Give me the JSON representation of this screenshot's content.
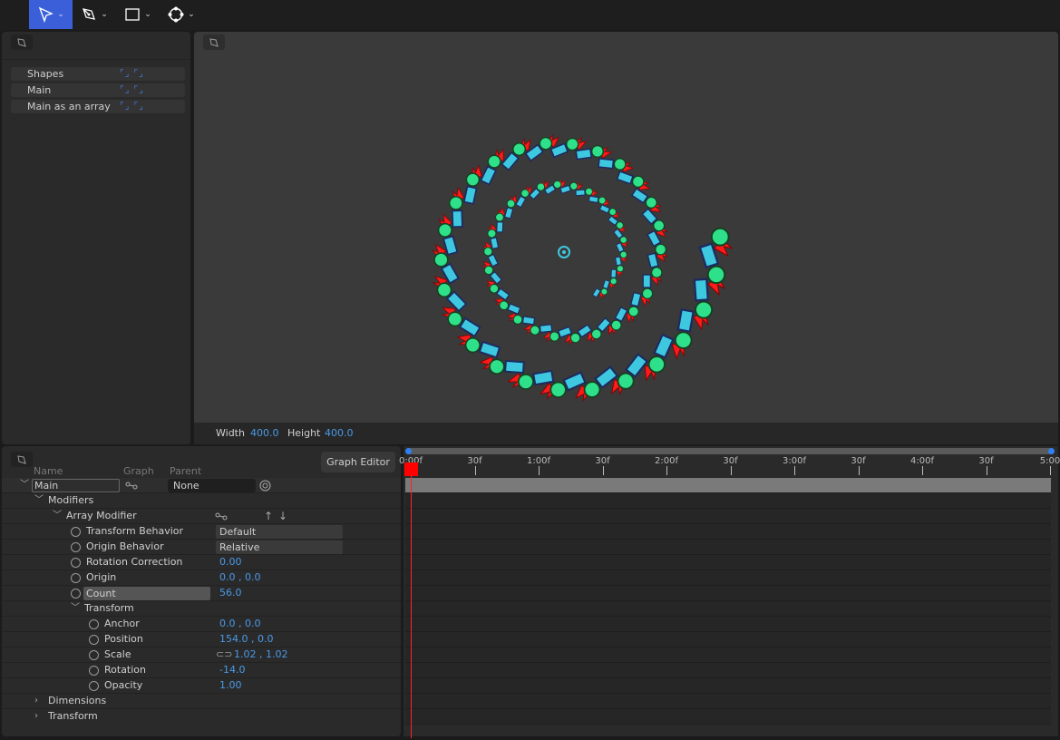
{
  "toolbar": {
    "tools": [
      "select",
      "pen",
      "rectangle",
      "ellipse"
    ]
  },
  "shapes_panel": {
    "items": [
      "Shapes",
      "Main",
      "Main as an array"
    ]
  },
  "canvas": {
    "width_label": "Width",
    "width": "400.0",
    "height_label": "Height",
    "height": "400.0",
    "array_count": 56
  },
  "properties": {
    "headers": {
      "name": "Name",
      "graph": "Graph",
      "parent": "Parent"
    },
    "graph_editor": "Graph Editor",
    "layer_name": "Main",
    "parent_value": "None",
    "modifiers": "Modifiers",
    "array_modifier": "Array Modifier",
    "rows": [
      {
        "label": "Transform Behavior",
        "value": "Default",
        "type": "drop"
      },
      {
        "label": "Origin Behavior",
        "value": "Relative",
        "type": "drop"
      },
      {
        "label": "Rotation Correction",
        "value": "0.00"
      },
      {
        "label": "Origin",
        "value": "0.0 , 0.0"
      },
      {
        "label": "Count",
        "value": "56.0"
      }
    ],
    "transform": "Transform",
    "transform_rows": [
      {
        "label": "Anchor",
        "value": "0.0 , 0.0"
      },
      {
        "label": "Position",
        "value": "154.0 , 0.0"
      },
      {
        "label": "Scale",
        "value": "1.02 , 1.02"
      },
      {
        "label": "Rotation",
        "value": "-14.0"
      },
      {
        "label": "Opacity",
        "value": "1.00"
      }
    ],
    "dimensions": "Dimensions",
    "transform2": "Transform"
  },
  "timeline": {
    "ticks": [
      "0:00f",
      "30f",
      "1:00f",
      "30f",
      "2:00f",
      "30f",
      "3:00f",
      "30f",
      "4:00f",
      "30f",
      "5:00"
    ],
    "playhead_color": "#ff0000"
  },
  "colors": {
    "accent": "#3a5fd8",
    "value": "#4a9ae8",
    "circle": "#2ee08a",
    "rect": "#3ec8e0",
    "flame": "#ff1a1a"
  }
}
